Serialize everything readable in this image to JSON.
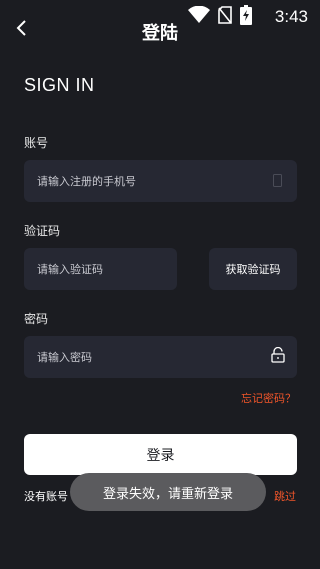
{
  "status_bar": {
    "time": "3:43"
  },
  "header": {
    "title": "登陆"
  },
  "heading": "SIGN IN",
  "account": {
    "label": "账号",
    "placeholder": "请输入注册的手机号"
  },
  "code": {
    "label": "验证码",
    "placeholder": "请输入验证码",
    "button": "获取验证码"
  },
  "password": {
    "label": "密码",
    "placeholder": "请输入密码"
  },
  "forgot": "忘记密码？",
  "login_button": "登录",
  "no_account": "没有账号",
  "skip": "跳过",
  "toast": "登录失效，请重新登录",
  "colors": {
    "background": "#1b1c21",
    "field": "#262833",
    "accent": "#f0552a"
  },
  "icons": [
    "wifi-icon",
    "no-sim-icon",
    "battery-charging-icon",
    "back-arrow-icon",
    "phone-icon",
    "lock-open-icon"
  ]
}
